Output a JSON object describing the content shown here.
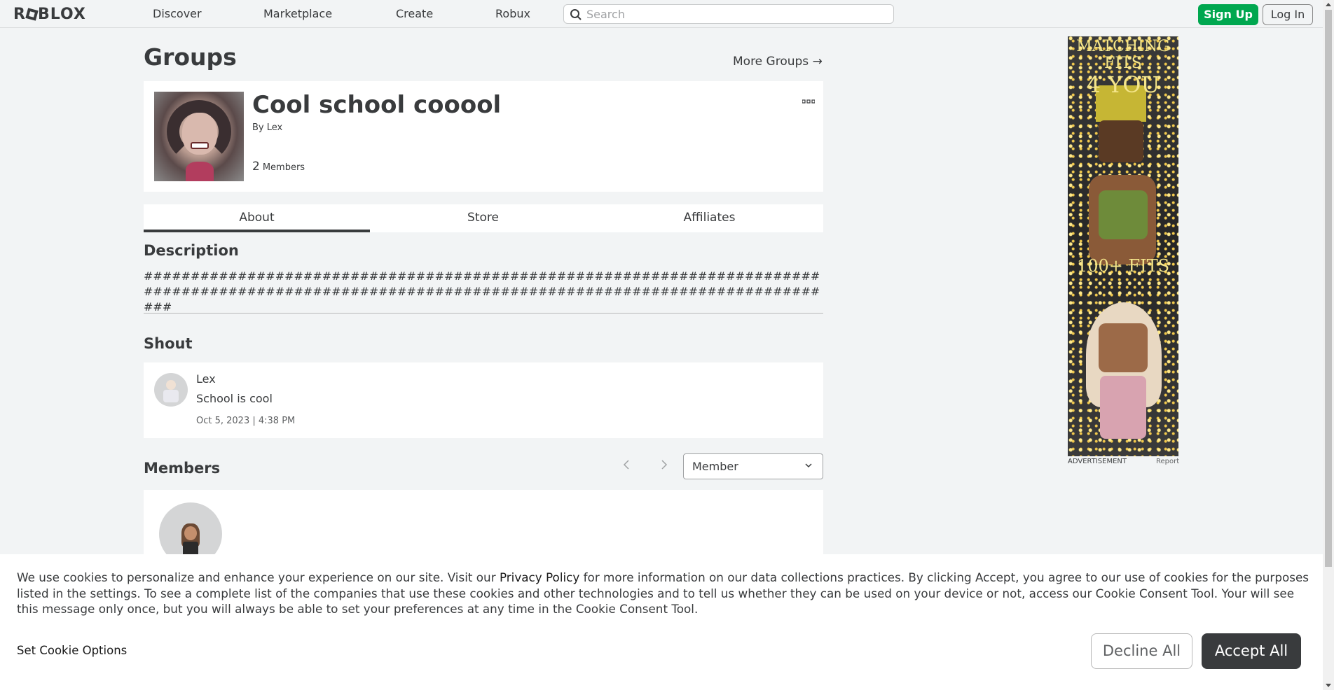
{
  "nav": {
    "logo": "ROBLOX",
    "logo_parts": [
      "R",
      "BLOX"
    ],
    "links": [
      "Discover",
      "Marketplace",
      "Create",
      "Robux"
    ],
    "search_placeholder": "Search",
    "sign_up": "Sign Up",
    "log_in": "Log In"
  },
  "page": {
    "title": "Groups",
    "more_groups": "More Groups →"
  },
  "group": {
    "name": "Cool school cooool",
    "by_label": "By",
    "owner": "Lex",
    "member_count": "2",
    "members_label": "Members",
    "more_icon": "more-dots-icon"
  },
  "tabs": [
    {
      "label": "About",
      "active": true
    },
    {
      "label": "Store",
      "active": false
    },
    {
      "label": "Affiliates",
      "active": false
    }
  ],
  "description": {
    "heading": "Description",
    "text": "###################################################################################################################################################"
  },
  "shout": {
    "heading": "Shout",
    "user": "Lex",
    "text": "School is cool",
    "date": "Oct 5, 2023 | 4:38 PM"
  },
  "members": {
    "heading": "Members",
    "role_selected": "Member"
  },
  "ad": {
    "line1": "MATCHING",
    "line2": "FITS",
    "line3": "4 YOU",
    "line4": "100+ FITS",
    "label": "ADVERTISEMENT",
    "report": "Report"
  },
  "cookie": {
    "text_before": "We use cookies to personalize and enhance your experience on our site. Visit our ",
    "privacy_link": "Privacy Policy",
    "text_after": " for more information on our data collections practices. By clicking Accept, you agree to our use of cookies for the purposes listed in the settings. To see a complete list of the companies that use these cookies and other technologies and to tell us whether they can be used on your device or not, access our Cookie Consent Tool. Your will see this message only once, but you will always be able to set your preferences at any time in the Cookie Consent Tool.",
    "set_options": "Set Cookie Options",
    "decline": "Decline All",
    "accept": "Accept All"
  },
  "colors": {
    "accent_green": "#00a74f",
    "page_bg": "#f2f4f5",
    "text_dark": "#393b3d",
    "accept_bg": "#393b3d"
  }
}
